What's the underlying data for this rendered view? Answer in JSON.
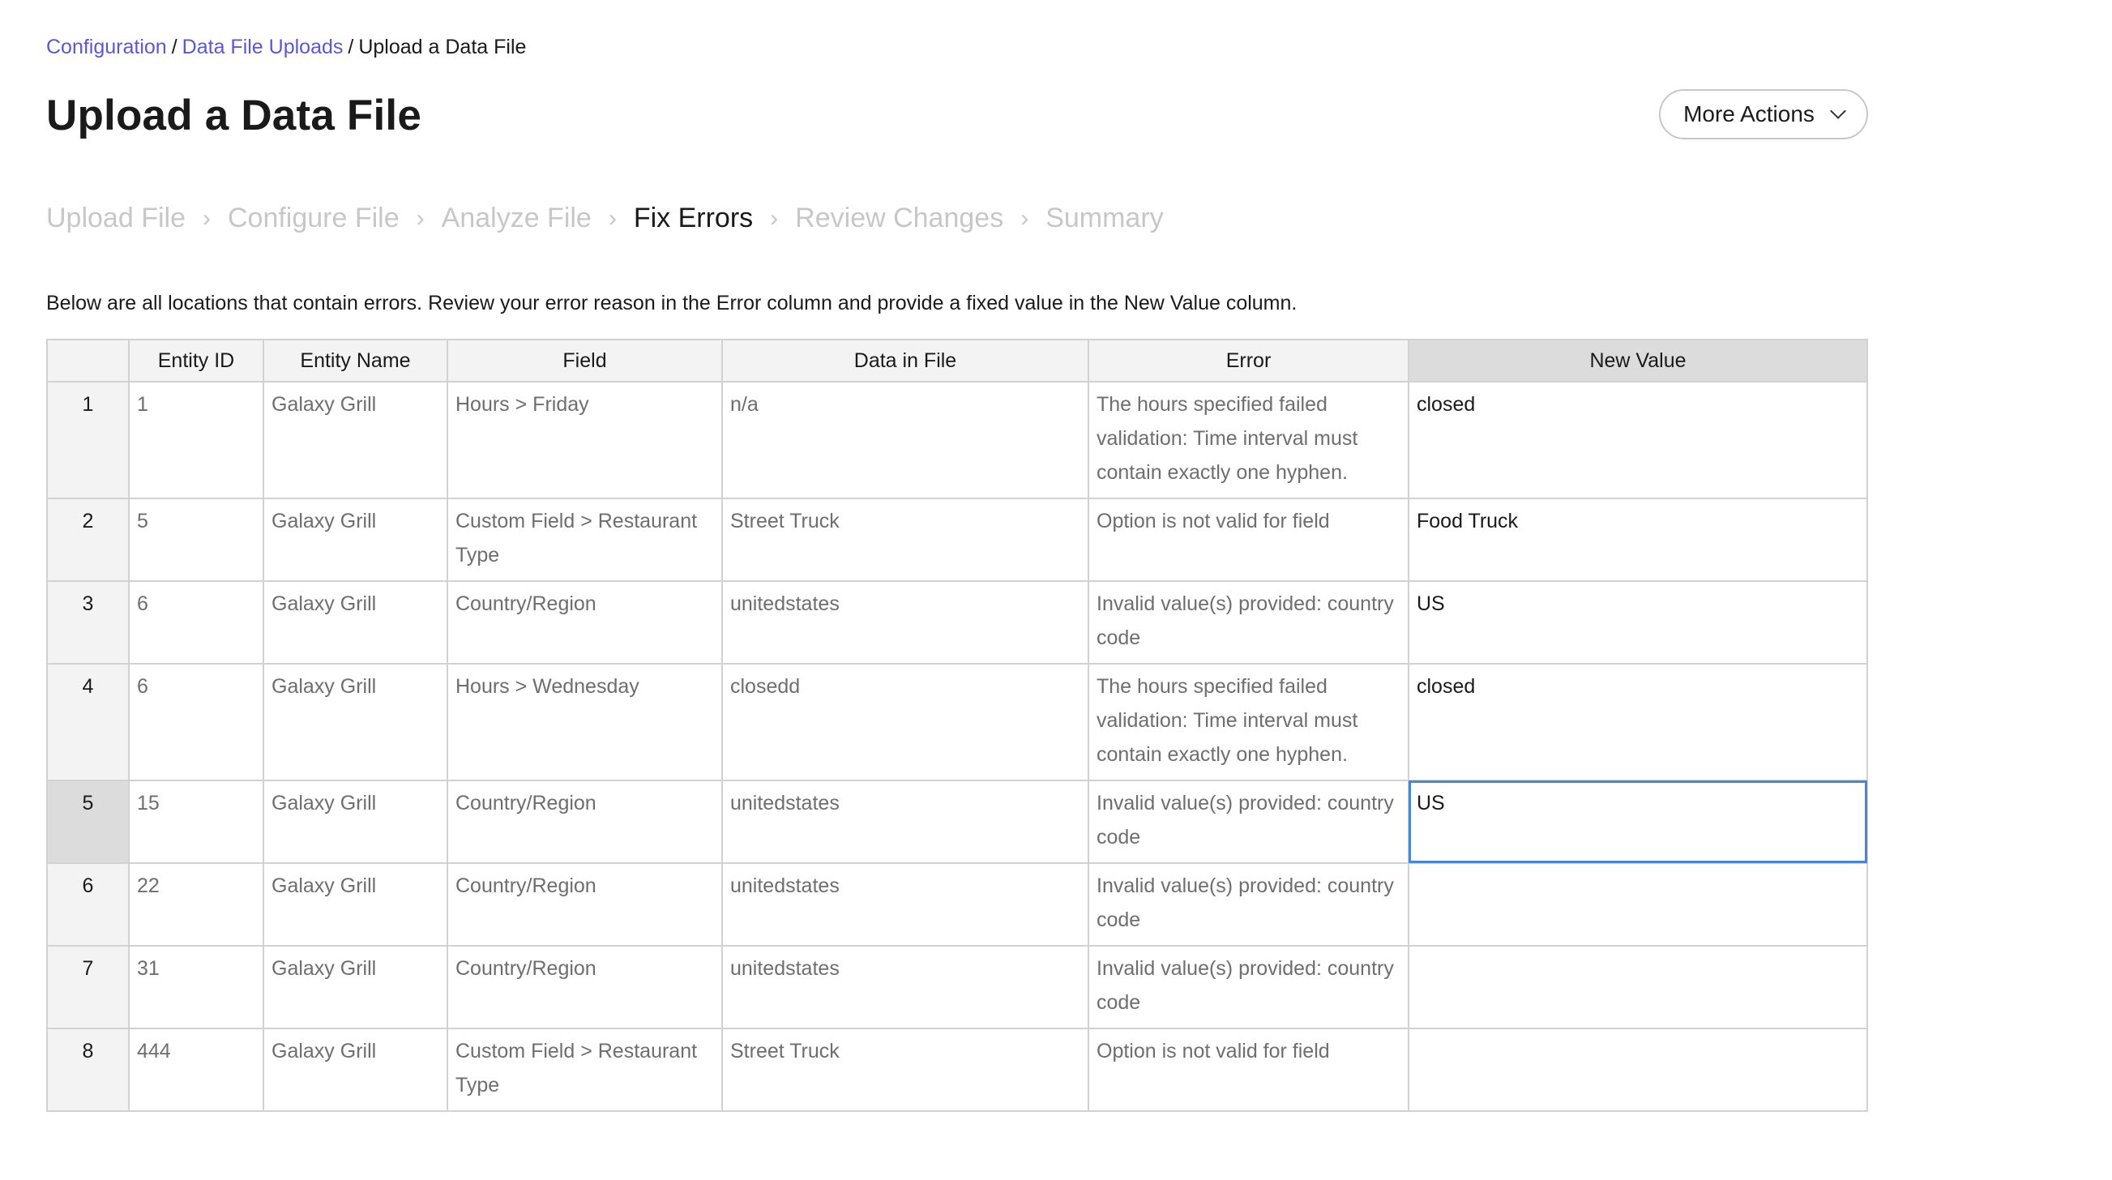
{
  "breadcrumb": {
    "items": [
      "Configuration",
      "Data File Uploads"
    ],
    "current": "Upload a Data File",
    "separator": "/"
  },
  "title": "Upload a Data File",
  "more_actions_label": "More Actions",
  "steps": [
    "Upload File",
    "Configure File",
    "Analyze File",
    "Fix Errors",
    "Review Changes",
    "Summary"
  ],
  "step_separator": "›",
  "active_step": "Fix Errors",
  "instructions": "Below are all locations that contain errors. Review your error reason in the Error column and provide a fixed value in the New Value column.",
  "table": {
    "headers": [
      "",
      "Entity ID",
      "Entity Name",
      "Field",
      "Data in File",
      "Error",
      "New Value"
    ],
    "rows": [
      {
        "num": "1",
        "entity_id": "1",
        "entity_name": "Galaxy Grill",
        "field": "Hours > Friday",
        "data": "n/a",
        "error": "The hours specified failed validation: Time interval must contain exactly one hyphen.",
        "new_value": "closed"
      },
      {
        "num": "2",
        "entity_id": "5",
        "entity_name": "Galaxy Grill",
        "field": "Custom Field > Restaurant Type",
        "data": "Street Truck",
        "error": "Option is not valid for field",
        "new_value": "Food Truck"
      },
      {
        "num": "3",
        "entity_id": "6",
        "entity_name": "Galaxy Grill",
        "field": "Country/Region",
        "data": "unitedstates",
        "error": "Invalid value(s) provided: country code",
        "new_value": "US"
      },
      {
        "num": "4",
        "entity_id": "6",
        "entity_name": "Galaxy Grill",
        "field": "Hours > Wednesday",
        "data": "closedd",
        "error": "The hours specified failed validation: Time interval must contain exactly one hyphen.",
        "new_value": "closed"
      },
      {
        "num": "5",
        "entity_id": "15",
        "entity_name": "Galaxy Grill",
        "field": "Country/Region",
        "data": "unitedstates",
        "error": "Invalid value(s) provided: country code",
        "new_value": "US"
      },
      {
        "num": "6",
        "entity_id": "22",
        "entity_name": "Galaxy Grill",
        "field": "Country/Region",
        "data": "unitedstates",
        "error": "Invalid value(s) provided: country code",
        "new_value": ""
      },
      {
        "num": "7",
        "entity_id": "31",
        "entity_name": "Galaxy Grill",
        "field": "Country/Region",
        "data": "unitedstates",
        "error": "Invalid value(s) provided: country code",
        "new_value": ""
      },
      {
        "num": "8",
        "entity_id": "444",
        "entity_name": "Galaxy Grill",
        "field": "Custom Field > Restaurant Type",
        "data": "Street Truck",
        "error": "Option is not valid for field",
        "new_value": ""
      }
    ],
    "selected_row": "5"
  },
  "colors": {
    "link": "#5b57d6",
    "focus_outline": "#4a86d8",
    "inactive_step": "#c7c7c7",
    "header_bg": "#f3f3f3",
    "selected_header_bg": "#dcdcdc"
  },
  "icons": {
    "more_actions": "chevron-down-icon"
  }
}
